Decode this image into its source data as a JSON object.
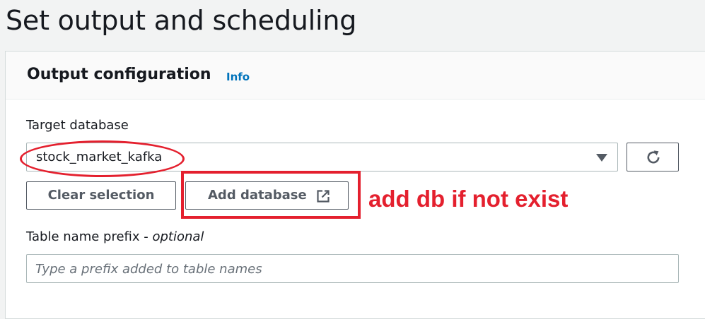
{
  "page": {
    "title": "Set output and scheduling"
  },
  "output_config": {
    "title": "Output configuration",
    "info_link": "Info",
    "target_database": {
      "label": "Target database",
      "selected_value": "stock_market_kafka"
    },
    "clear_selection_label": "Clear selection",
    "add_database_label": "Add database",
    "table_prefix": {
      "label": "Table name prefix - ",
      "optional_text": "optional",
      "placeholder": "Type a prefix added to table names",
      "value": ""
    }
  },
  "annotation": {
    "note": "add db if not exist",
    "color": "#e4202e"
  },
  "icons": {
    "select_caret": "caret-down-icon",
    "refresh": "refresh-icon",
    "external_link": "external-link-icon"
  },
  "colors": {
    "link": "#0073bb",
    "button_text": "#545b64",
    "page_background": "#f2f3f3"
  }
}
